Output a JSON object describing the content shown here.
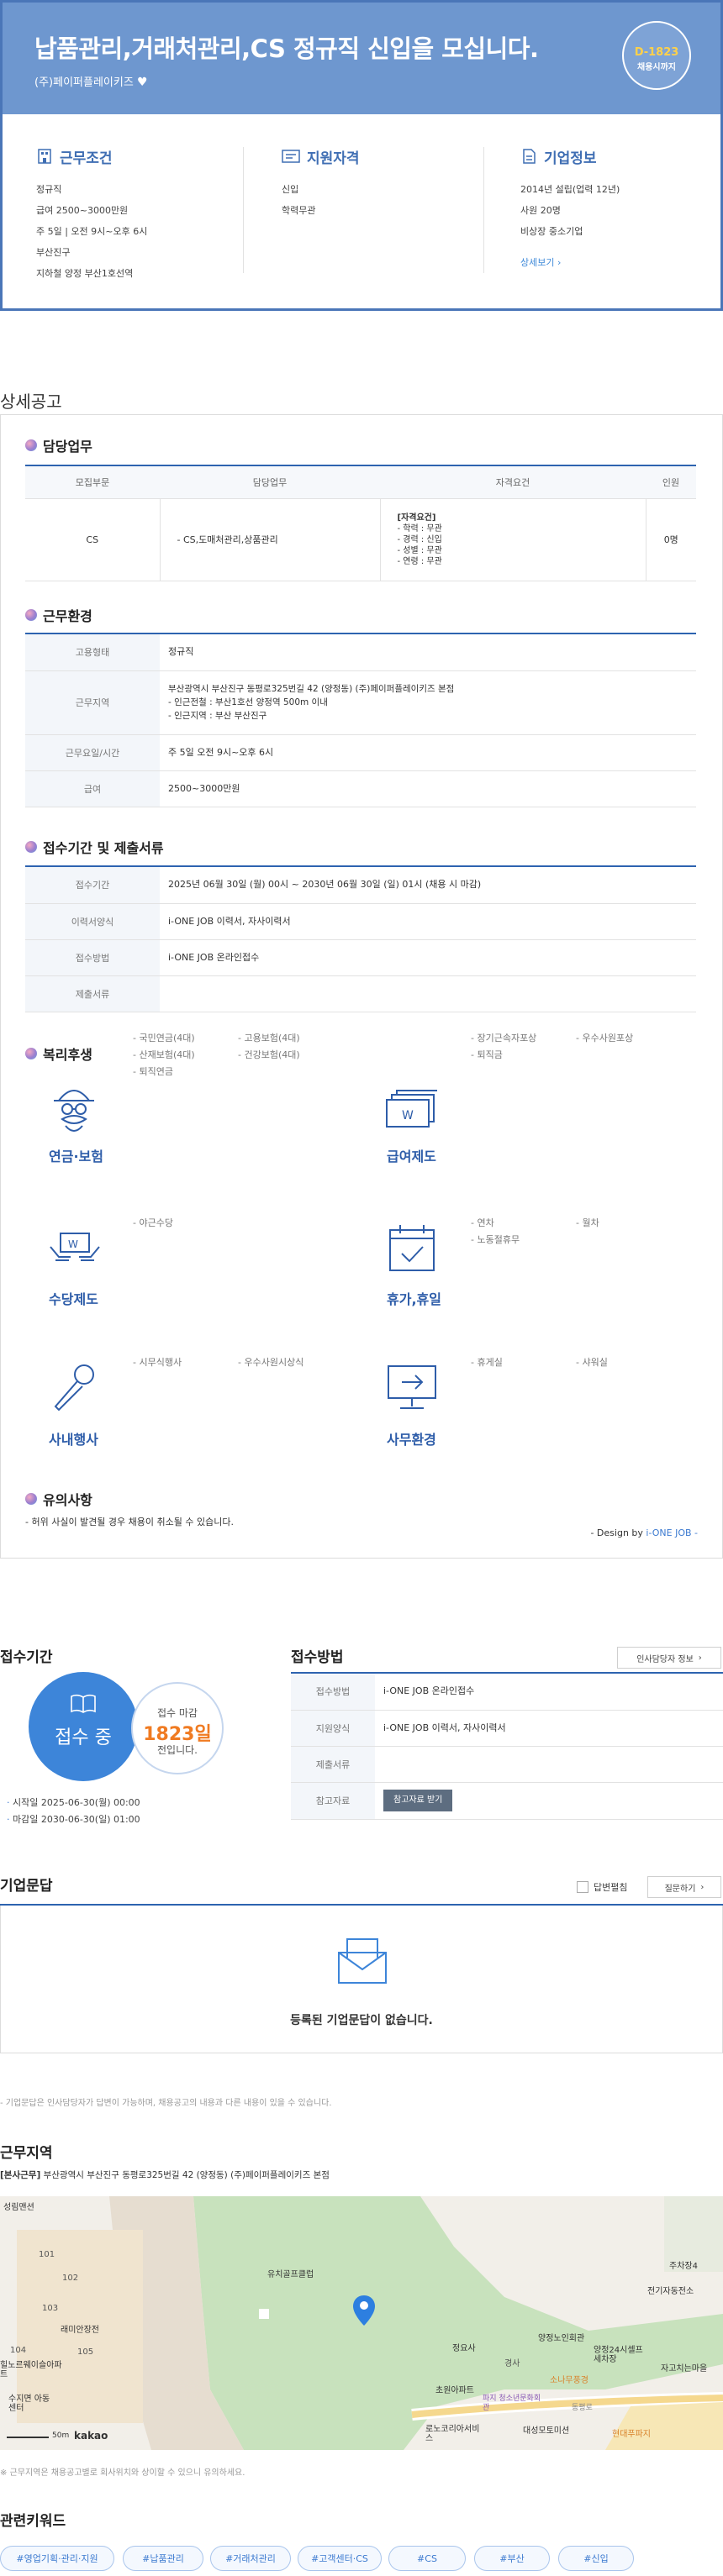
{
  "header": {
    "title": "납품관리,거래처관리,CS 정규직 신입을 모십니다.",
    "company": "(주)페이퍼플레이키즈",
    "dday": "D-1823",
    "dday_sub": "채용시까지"
  },
  "conditions": {
    "title": "근무조건",
    "items": [
      "정규직",
      "급여 2500~3000만원",
      "주 5일 | 오전 9시~오후 6시",
      "부산진구",
      "지하철 양정 부산1호선역"
    ]
  },
  "qualification": {
    "title": "지원자격",
    "items": [
      "신입",
      "학력무관"
    ]
  },
  "company_info": {
    "title": "기업정보",
    "items": [
      "2014년 설립(업력 12년)",
      "사원 20명",
      "비상장 중소기업"
    ],
    "more": "상세보기"
  },
  "detail_title": "상세공고",
  "duty": {
    "title": "담당업무",
    "headers": [
      "모집부문",
      "담당업무",
      "자격요건",
      "인원"
    ],
    "row": {
      "dept": "CS",
      "task": "- CS,도매처관리,상품관리",
      "req_title": "[자격요건]",
      "req": [
        "- 학력 : 무관",
        "- 경력 : 신입",
        "- 성별 : 무관",
        "- 연령 : 무관"
      ],
      "count": "0명"
    }
  },
  "env": {
    "title": "근무환경",
    "rows": [
      {
        "k": "고용형태",
        "v": [
          "정규직"
        ]
      },
      {
        "k": "근무지역",
        "v": [
          "부산광역시 부산진구 동평로325번길 42 (양정동) (주)페이퍼플레이키즈 본점",
          "- 인근전철 : 부산1호선 양정역 500m 이내",
          "- 인근지역 : 부산 부산진구"
        ]
      },
      {
        "k": "근무요일/시간",
        "v": [
          "주 5일 오전 9시~오후 6시"
        ]
      },
      {
        "k": "급여",
        "v": [
          "2500~3000만원"
        ]
      }
    ]
  },
  "apply": {
    "title": "접수기간 및 제출서류",
    "rows": [
      {
        "k": "접수기간",
        "v": "2025년 06월 30일 (월) 00시 ~ 2030년 06월 30일 (일) 01시 (채용 시 마감)"
      },
      {
        "k": "이력서양식",
        "v": "i-ONE JOB 이력서, 자사이력서"
      },
      {
        "k": "접수방법",
        "v": "i-ONE JOB 온라인접수"
      },
      {
        "k": "제출서류",
        "v": ""
      }
    ]
  },
  "welfare": {
    "title": "복리후생",
    "groups": [
      {
        "label": "연금·보험",
        "icon": "pension-icon",
        "items": [
          "국민연금(4대)",
          "고용보험(4대)",
          "산재보험(4대)",
          "건강보험(4대)",
          "퇴직연금"
        ]
      },
      {
        "label": "급여제도",
        "icon": "salary-icon",
        "items": [
          "장기근속자포상",
          "우수사원포상",
          "퇴직금"
        ]
      },
      {
        "label": "수당제도",
        "icon": "allowance-icon",
        "items": [
          "야근수당"
        ]
      },
      {
        "label": "휴가,휴일",
        "icon": "calendar-icon",
        "items": [
          "연차",
          "월차",
          "노동절휴무"
        ]
      },
      {
        "label": "사내행사",
        "icon": "microphone-icon",
        "items": [
          "시무식행사",
          "우수사원시상식"
        ]
      },
      {
        "label": "사무환경",
        "icon": "monitor-icon",
        "items": [
          "휴게실",
          "샤워실"
        ]
      }
    ]
  },
  "notice": {
    "title": "유의사항",
    "text": "- 허위 사실이 발견될 경우 채용이 취소될 수 있습니다.",
    "design_prefix": "- Design by",
    "design_brand": "i-ONE JOB -"
  },
  "period": {
    "title": "접수기간",
    "status": "접수 중",
    "deadline_label": "접수 마감",
    "deadline_days": "1823일",
    "deadline_suffix": "전입니다.",
    "start": "시작일 2025-06-30(월) 00:00",
    "end": "마감일 2030-06-30(일) 01:00"
  },
  "method": {
    "title": "접수방법",
    "contact_button": "인사담당자 정보",
    "rows": [
      {
        "k": "접수방법",
        "v": "i-ONE JOB 온라인접수"
      },
      {
        "k": "지원양식",
        "v": "i-ONE JOB 이력서, 자사이력서"
      },
      {
        "k": "제출서류",
        "v": ""
      },
      {
        "k": "참고자료",
        "v": ""
      }
    ],
    "download_button": "참고자료 받기"
  },
  "qna": {
    "title": "기업문답",
    "check_label": "답변펼침",
    "ask_button": "질문하기",
    "empty": "등록된 기업문답이 없습니다.",
    "footnote": "- 기업문답은 인사담당자가 답변이 가능하며, 채용공고의 내용과 다른 내용이 있을 수 있습니다."
  },
  "location": {
    "title": "근무지역",
    "tag": "[본사근무]",
    "address": "부산광역시 부산진구 동평로325번길 42 (양정동) (주)페이퍼플레이키즈 본점",
    "footnote": "※ 근무지역은 채용공고별로 회사위치와 상이할 수 있으니 유의하세요.",
    "map_labels": [
      "성림맨션",
      "101",
      "102",
      "103",
      "105",
      "104",
      "래미안장전",
      "유치골프클럽",
      "정요사",
      "초원아파트",
      "양정24시셀프세차장",
      "자고치는마을",
      "주차장4",
      "전기자동전소",
      "소나무풍경",
      "경사",
      "현대푸파지",
      "대성모토미션",
      "파지 청소년문화회관",
      "로노코리아서비스",
      "양정노인회관",
      "수지면 아동센터",
      "힐노르웨이슬아파트",
      "동평로"
    ],
    "scale": "50m",
    "brand": "kakao"
  },
  "keywords": {
    "title": "관련키워드",
    "items": [
      "#영업기획·관리·지원",
      "#납품관리",
      "#거래처관리",
      "#고객센터·CS",
      "#CS",
      "#부산",
      "#신입"
    ]
  }
}
